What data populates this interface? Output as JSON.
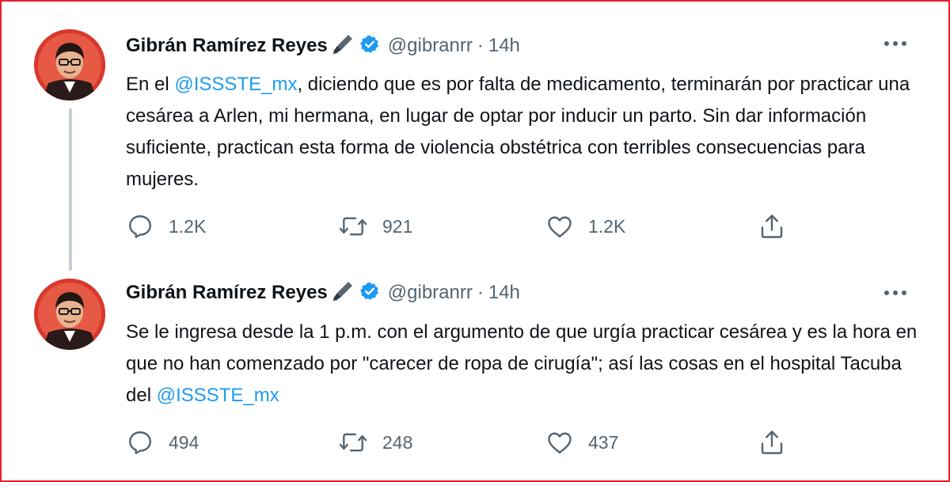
{
  "author": {
    "name": "Gibrán Ramírez Reyes",
    "handle": "@gibranrr"
  },
  "tweets": [
    {
      "time": "14h",
      "text_parts": [
        "En el ",
        "@ISSSTE_mx",
        ", diciendo que es por falta de medicamento, terminarán por practicar una cesárea a Arlen, mi hermana, en lugar de optar por inducir un parto. Sin dar información suficiente, practican esta forma de violencia obstétrica con terribles consecuencias para mujeres."
      ],
      "replies": "1.2K",
      "retweets": "921",
      "likes": "1.2K"
    },
    {
      "time": "14h",
      "text_parts": [
        "Se le ingresa desde la 1 p.m. con el argumento de que urgía practicar cesárea y es la hora en que no han comenzado por \"carecer de ropa de cirugía\"; así las cosas en el hospital Tacuba del ",
        "@ISSSTE_mx"
      ],
      "replies": "494",
      "retweets": "248",
      "likes": "437"
    }
  ],
  "separator": "·",
  "icons": {
    "reply": "reply-icon",
    "retweet": "retweet-icon",
    "like": "heart-icon",
    "share": "share-icon",
    "more": "more-icon",
    "verified": "verified-badge-icon",
    "pen": "fountain-pen-icon"
  },
  "colors": {
    "frame_border": "#e3212c",
    "mention": "#1d9bf0",
    "verified": "#1d9bf0",
    "secondary_text": "#536471",
    "avatar_bg": "#d9382e"
  }
}
